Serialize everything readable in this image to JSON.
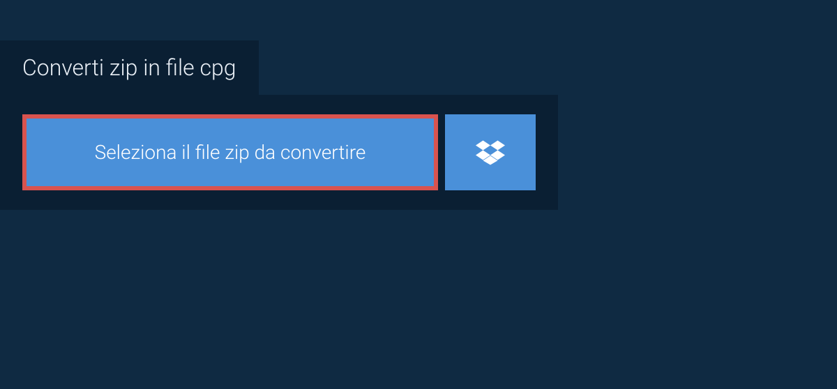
{
  "tab": {
    "title": "Converti zip in file cpg"
  },
  "buttons": {
    "select_file_label": "Seleziona il file zip da convertire"
  },
  "icons": {
    "dropbox": "dropbox-icon"
  },
  "colors": {
    "page_bg": "#0f2a42",
    "panel_bg": "#0a1f33",
    "button_bg": "#4a90d9",
    "highlight_border": "#d9534f",
    "text_light": "#ffffff"
  }
}
